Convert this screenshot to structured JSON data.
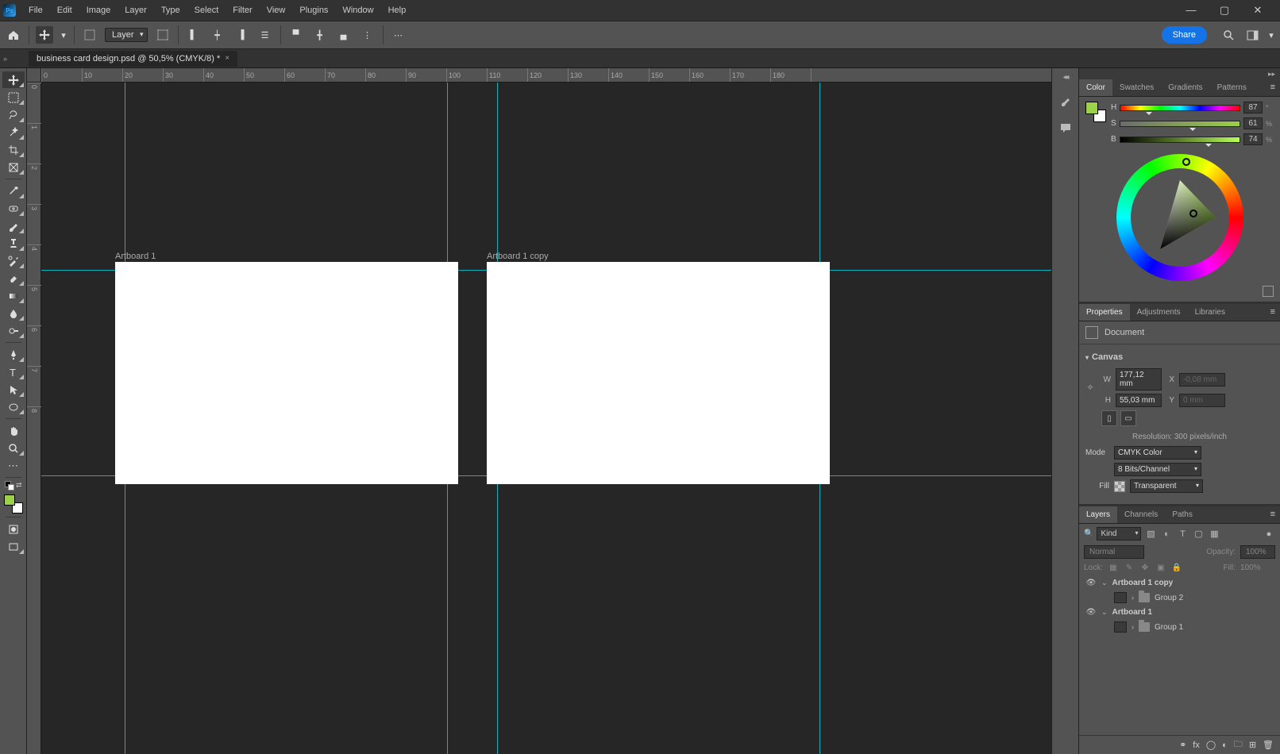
{
  "menu": [
    "File",
    "Edit",
    "Image",
    "Layer",
    "Type",
    "Select",
    "Filter",
    "View",
    "Plugins",
    "Window",
    "Help"
  ],
  "options": {
    "layer_mode": "Layer",
    "share": "Share"
  },
  "doc_tab": {
    "title": "business card design.psd @ 50,5% (CMYK/8) *"
  },
  "ruler_h": [
    "0",
    "10",
    "20",
    "30",
    "40",
    "50",
    "60",
    "70",
    "80",
    "90",
    "100",
    "110",
    "120",
    "130",
    "140",
    "150",
    "160",
    "170",
    "180",
    ""
  ],
  "ruler_v": [
    "0",
    "1",
    "2",
    "3",
    "4",
    "5",
    "6",
    "7",
    "8"
  ],
  "artboards": {
    "a1_label": "Artboard 1",
    "a2_label": "Artboard 1 copy"
  },
  "right_tabs": {
    "color": [
      "Color",
      "Swatches",
      "Gradients",
      "Patterns"
    ],
    "props": [
      "Properties",
      "Adjustments",
      "Libraries"
    ],
    "layers": [
      "Layers",
      "Channels",
      "Paths"
    ]
  },
  "hsb": {
    "H": {
      "label": "H",
      "value": "87",
      "unit": "°"
    },
    "S": {
      "label": "S",
      "value": "61",
      "unit": "%"
    },
    "B": {
      "label": "B",
      "value": "74",
      "unit": "%"
    }
  },
  "properties": {
    "doc_label": "Document",
    "canvas_label": "Canvas",
    "W_label": "W",
    "W_value": "177,12 mm",
    "H_label": "H",
    "H_value": "55,03 mm",
    "X_label": "X",
    "X_value": "-0,08 mm",
    "Y_label": "Y",
    "Y_value": "0 mm",
    "resolution": "Resolution: 300 pixels/inch",
    "mode_label": "Mode",
    "mode_value": "CMYK Color",
    "depth_value": "8 Bits/Channel",
    "fill_label": "Fill",
    "fill_value": "Transparent"
  },
  "layers": {
    "kind_label": "Kind",
    "blend_label": "Normal",
    "opacity_label": "Opacity:",
    "opacity_val": "100%",
    "lock_label": "Lock:",
    "fill_label": "Fill:",
    "fill_val": "100%",
    "items": [
      {
        "type": "artboard",
        "name": "Artboard 1 copy",
        "eye": true
      },
      {
        "type": "group",
        "name": "Group 2",
        "indent": 1
      },
      {
        "type": "artboard",
        "name": "Artboard 1",
        "eye": true
      },
      {
        "type": "group",
        "name": "Group 1",
        "indent": 1
      }
    ]
  }
}
